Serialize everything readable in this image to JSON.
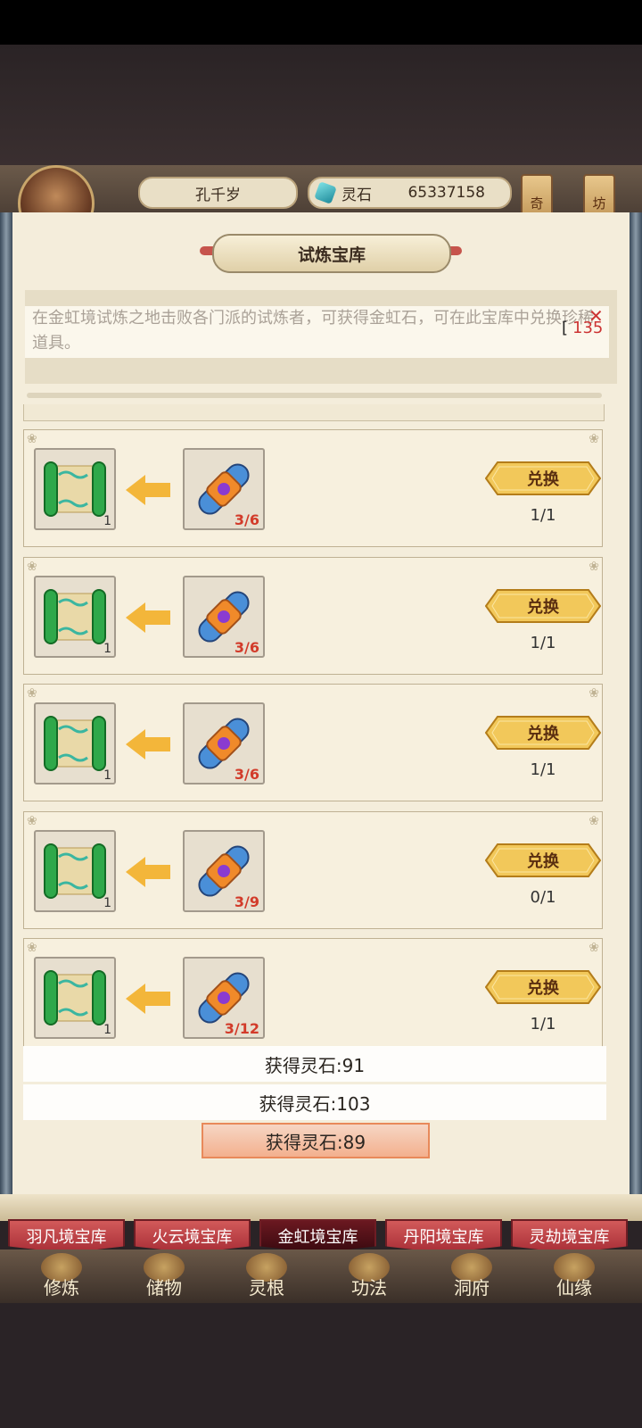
{
  "header": {
    "player_name": "孔千岁",
    "currency_label": "灵石",
    "currency_value": "65337158",
    "side_tags": [
      "奇",
      "坊"
    ]
  },
  "panel": {
    "title": "试炼宝库",
    "description": "在金虹境试炼之地击败各门派的试炼者，可获得金虹石，可在此宝库中兑换珍稀道具。",
    "counter_text": "135"
  },
  "exchange_list": [
    {
      "reward_count": "1",
      "cost": "3/6",
      "button": "兑换",
      "limit": "1/1"
    },
    {
      "reward_count": "1",
      "cost": "3/6",
      "button": "兑换",
      "limit": "1/1"
    },
    {
      "reward_count": "1",
      "cost": "3/6",
      "button": "兑换",
      "limit": "1/1"
    },
    {
      "reward_count": "1",
      "cost": "3/9",
      "button": "兑换",
      "limit": "0/1"
    },
    {
      "reward_count": "1",
      "cost": "3/12",
      "button": "兑换",
      "limit": "1/1"
    }
  ],
  "toasts": [
    "获得灵石:91",
    "获得灵石:103",
    "获得灵石:89"
  ],
  "realm_tabs": [
    "羽凡境宝库",
    "火云境宝库",
    "金虹境宝库",
    "丹阳境宝库",
    "灵劫境宝库"
  ],
  "active_realm_tab": "金虹境宝库",
  "bottom_nav": [
    "修炼",
    "储物",
    "灵根",
    "功法",
    "洞府",
    "仙缘"
  ],
  "colors": {
    "panel_bg": "#f4eddb",
    "button_gold": "#e8b84a",
    "cost_red": "#d23b2a",
    "tab_red": "#a92f38"
  }
}
